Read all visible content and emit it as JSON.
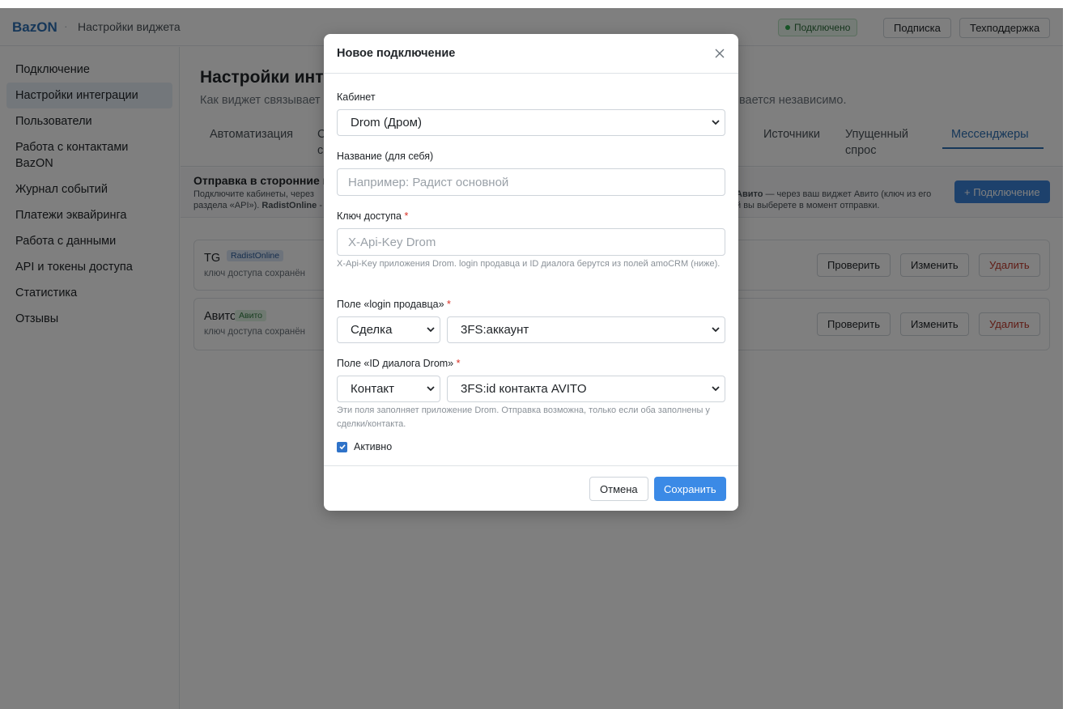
{
  "topbar": {
    "brand": "BazON",
    "separator": "·",
    "crumb": "Настройки виджета",
    "status": "Подключено",
    "subscription": "Подписка",
    "support": "Техподдержка"
  },
  "sidebar": {
    "items": [
      "Подключение",
      "Настройки интеграции",
      "Пользователи",
      "Работа с контактами BazON",
      "Журнал событий",
      "Платежи эквайринга",
      "Работа с данными",
      "API и токены доступа",
      "Статистика",
      "Отзывы"
    ]
  },
  "main": {
    "title": "Настройки инте",
    "subtitle": "Как виджет связывает",
    "subtitle_tail": "вается независимо.",
    "tabs": [
      "Автоматизация",
      "С с",
      "Источники",
      "Упущенный спрос",
      "Мессенджеры"
    ],
    "panel_title": "Отправка в сторонние м",
    "panel_desc_1": "Подключите кабинеты, через",
    "panel_desc_2_bold": "RadistOnline",
    "panel_desc_2_pre": "раздела «API»). ",
    "panel_desc_2_post": " -",
    "panel_desc_r_bold": "Авито",
    "panel_desc_r1": " — через ваш виджет Авито (ключ из его",
    "panel_desc_r2": "й вы выберете в момент отправки.",
    "add_button": "+ Подключение",
    "connections": [
      {
        "name": "TG",
        "tag": "RadistOnline",
        "note": "ключ доступа сохранён"
      },
      {
        "name": "Авито",
        "tag": "Авито",
        "note": "ключ доступа сохранён"
      }
    ],
    "check_button": "Проверить",
    "edit_button": "Изменить",
    "delete_button": "Удалить"
  },
  "modal": {
    "title": "Новое подключение",
    "cabinet_label": "Кабинет",
    "cabinet_value": "Drom (Дром)",
    "name_label": "Название (для себя)",
    "name_placeholder": "Например: Радист основной",
    "key_label": "Ключ доступа",
    "key_placeholder": "X-Api-Key Drom",
    "key_hint": "X-Api-Key приложения Drom. login продавца и ID диалога берутся из полей amoCRM (ниже).",
    "login_label": "Поле «login продавца»",
    "login_entity": "Сделка",
    "login_field": "3FS:аккаунт",
    "dialog_label": "Поле «ID диалога Drom»",
    "dialog_entity": "Контакт",
    "dialog_field": "3FS:id контакта AVITO",
    "fields_hint": "Эти поля заполняет приложение Drom. Отправка возможна, только если оба заполнены у сделки/контакта.",
    "active_label": "Активно",
    "required_mark": "*",
    "cancel": "Отмена",
    "save": "Сохранить"
  },
  "colors": {
    "accent": "#2c6fb3",
    "primary_button": "#3b8ae6",
    "danger": "#c0392b",
    "success": "#2fa84f"
  }
}
